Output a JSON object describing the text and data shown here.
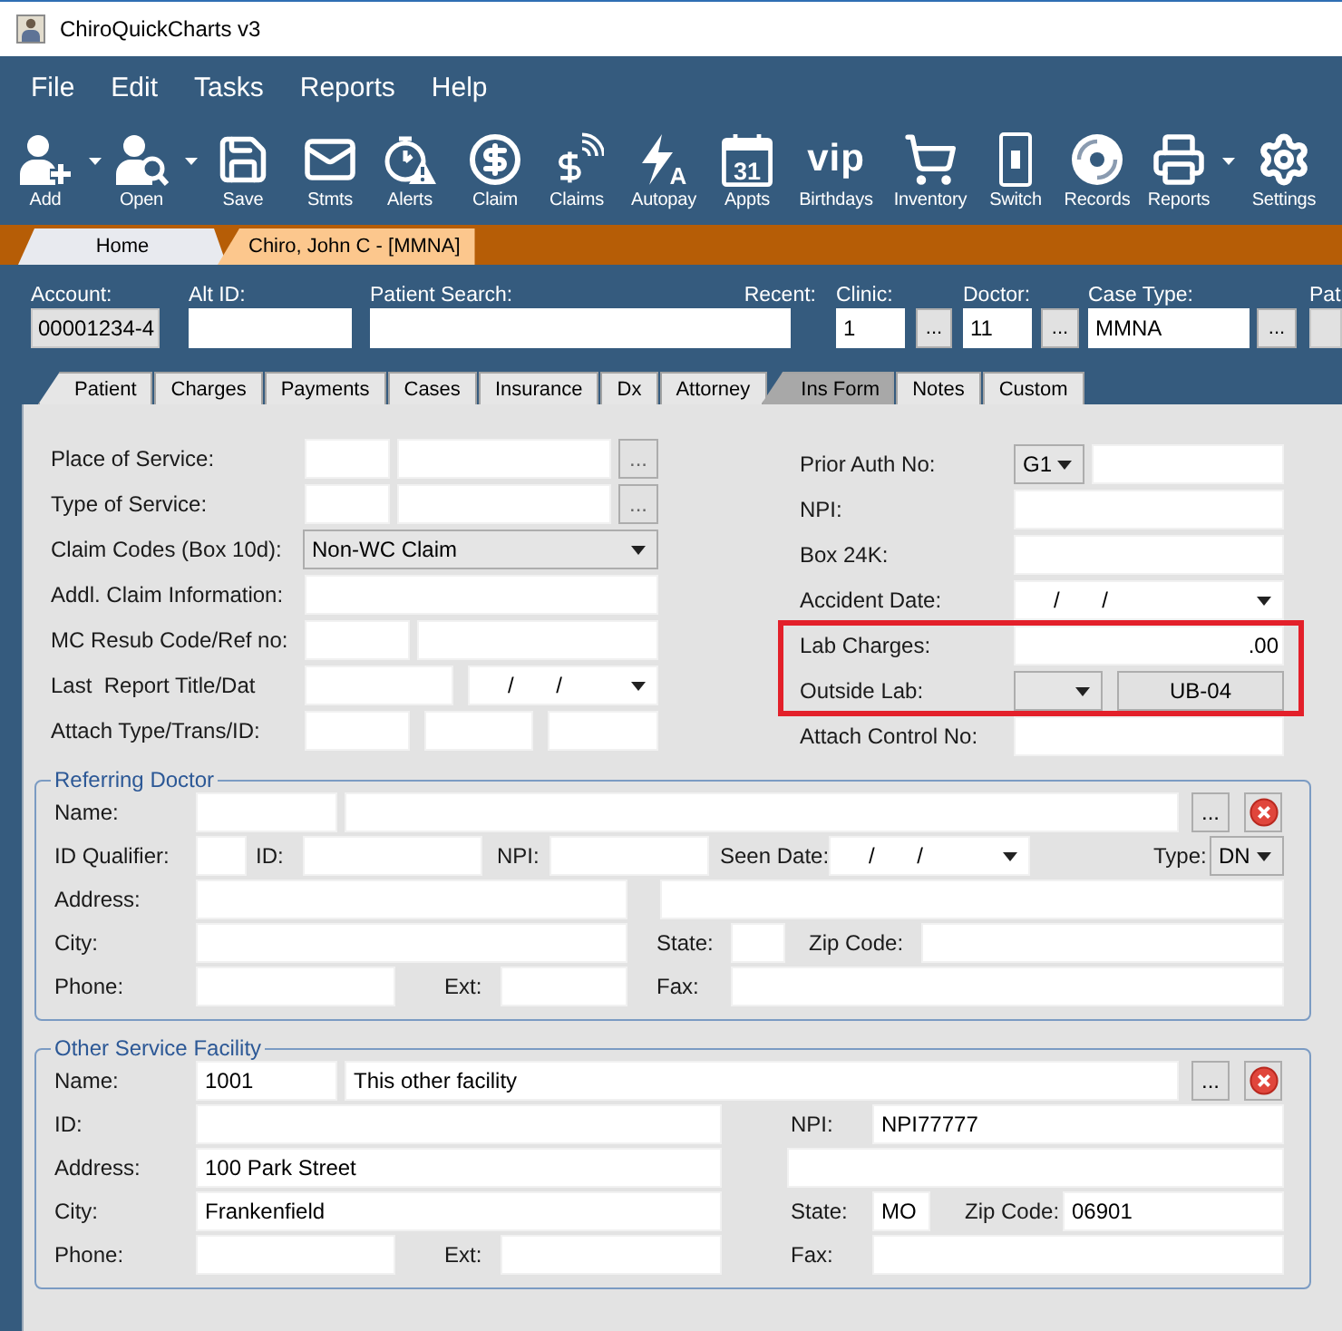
{
  "window": {
    "title": "ChiroQuickCharts v3"
  },
  "menu": [
    "File",
    "Edit",
    "Tasks",
    "Reports",
    "Help"
  ],
  "toolbar": [
    {
      "label": "Add",
      "dropdown": true
    },
    {
      "label": "Open",
      "dropdown": true
    },
    {
      "label": "Save",
      "dropdown": false
    },
    {
      "label": "Stmts",
      "dropdown": false
    },
    {
      "label": "Alerts",
      "dropdown": false
    },
    {
      "label": "Claim",
      "dropdown": false
    },
    {
      "label": "Claims",
      "dropdown": false
    },
    {
      "label": "Autopay",
      "dropdown": false,
      "icon_text": "A"
    },
    {
      "label": "Appts",
      "dropdown": false,
      "icon_text": "31"
    },
    {
      "label": "Birthdays",
      "dropdown": false,
      "icon_text": "vip"
    },
    {
      "label": "Inventory",
      "dropdown": false
    },
    {
      "label": "Switch",
      "dropdown": false
    },
    {
      "label": "Records",
      "dropdown": false
    },
    {
      "label": "Reports",
      "dropdown": true
    },
    {
      "label": "Settings",
      "dropdown": false
    }
  ],
  "document_tabs": [
    {
      "label": "Home",
      "selected": false
    },
    {
      "label": "Chiro, John C - [MMNA]",
      "selected": true
    }
  ],
  "header": [
    {
      "label": "Account:",
      "kind": "readonly",
      "value": "00001234-4"
    },
    {
      "label": "Alt ID:",
      "kind": "input"
    },
    {
      "label": "Patient Search:",
      "kind": "input",
      "aside": "Recent:"
    },
    {
      "label": "Clinic:",
      "kind": "picker",
      "value": "1",
      "button": "..."
    },
    {
      "label": "Doctor:",
      "kind": "picker",
      "value": "11",
      "button": "..."
    },
    {
      "label": "Case Type:",
      "kind": "picker",
      "value": "MMNA",
      "button": "..."
    },
    {
      "label": "Pat",
      "kind": "readonly"
    }
  ],
  "tabs": [
    {
      "label": "Patient",
      "selected": false
    },
    {
      "label": "Charges",
      "selected": false
    },
    {
      "label": "Payments",
      "selected": false
    },
    {
      "label": "Cases",
      "selected": false
    },
    {
      "label": "Insurance",
      "selected": false
    },
    {
      "label": "Dx",
      "selected": false
    },
    {
      "label": "Attorney",
      "selected": false
    },
    {
      "label": "Ins Form",
      "selected": true
    },
    {
      "label": "Notes",
      "selected": false
    },
    {
      "label": "Custom",
      "selected": false
    }
  ],
  "ins_form": {
    "left": [
      {
        "label": "Place of Service:",
        "controls": [
          {
            "kind": "field"
          },
          {
            "kind": "field"
          },
          {
            "kind": "browse",
            "text": "..."
          }
        ]
      },
      {
        "label": "Type of Service:",
        "controls": [
          {
            "kind": "field"
          },
          {
            "kind": "field"
          },
          {
            "kind": "browse",
            "text": "..."
          }
        ]
      },
      {
        "label": "Claim Codes (Box 10d):",
        "controls": [
          {
            "kind": "dropdown",
            "value": "Non-WC Claim"
          }
        ]
      },
      {
        "label": "Addl. Claim Information:",
        "controls": [
          {
            "kind": "field"
          }
        ]
      },
      {
        "label": "MC Resub Code/Ref no:",
        "controls": [
          {
            "kind": "field"
          },
          {
            "kind": "field"
          }
        ]
      },
      {
        "label": "Last  Report Title/Dat",
        "controls": [
          {
            "kind": "field"
          },
          {
            "kind": "date",
            "value": "/       /"
          }
        ]
      },
      {
        "label": "Attach Type/Trans/ID:",
        "controls": [
          {
            "kind": "field"
          },
          {
            "kind": "field"
          },
          {
            "kind": "field"
          }
        ]
      }
    ],
    "right": [
      {
        "label": "Prior Auth No:",
        "highlighted": false,
        "controls": [
          {
            "kind": "dropdown",
            "value": "G1"
          },
          {
            "kind": "field"
          }
        ]
      },
      {
        "label": "NPI:",
        "highlighted": false,
        "controls": [
          {
            "kind": "field"
          }
        ]
      },
      {
        "label": "Box 24K:",
        "highlighted": false,
        "controls": [
          {
            "kind": "field"
          }
        ]
      },
      {
        "label": "Accident Date:",
        "highlighted": false,
        "controls": [
          {
            "kind": "date",
            "value": "/       /"
          }
        ]
      },
      {
        "label": "Lab Charges:",
        "highlighted": true,
        "controls": [
          {
            "kind": "amount",
            "value": ".00"
          }
        ]
      },
      {
        "label": "Outside Lab:",
        "highlighted": true,
        "controls": [
          {
            "kind": "dropdown"
          },
          {
            "kind": "button",
            "text": "UB-04"
          }
        ]
      },
      {
        "label": "Attach Control No:",
        "highlighted": false,
        "controls": [
          {
            "kind": "field"
          }
        ]
      }
    ]
  },
  "referring_doctor": {
    "title": "Referring Doctor",
    "rows": [
      {
        "left": [
          {
            "kind": "label",
            "text": "Name:"
          },
          {
            "kind": "field"
          },
          {
            "kind": "field"
          },
          {
            "kind": "browse",
            "text": "..."
          },
          {
            "kind": "clear"
          }
        ]
      },
      {
        "left": [
          {
            "kind": "label",
            "text": "ID Qualifier:"
          },
          {
            "kind": "field"
          },
          {
            "kind": "label",
            "text": "ID:"
          },
          {
            "kind": "field"
          },
          {
            "kind": "label",
            "text": "NPI:"
          },
          {
            "kind": "field"
          }
        ],
        "right": [
          {
            "kind": "label",
            "text": "Seen Date:"
          },
          {
            "kind": "date",
            "value": "/       /"
          },
          {
            "kind": "label",
            "text": "Type:"
          },
          {
            "kind": "dropdown",
            "value": "DN"
          }
        ]
      },
      {
        "left": [
          {
            "kind": "label",
            "text": "Address:"
          },
          {
            "kind": "field"
          }
        ],
        "right": [
          {
            "kind": "field"
          }
        ]
      },
      {
        "left": [
          {
            "kind": "label",
            "text": "City:"
          },
          {
            "kind": "field"
          }
        ],
        "right": [
          {
            "kind": "label",
            "text": "State:"
          },
          {
            "kind": "field"
          },
          {
            "kind": "label",
            "text": "Zip Code:"
          },
          {
            "kind": "field"
          }
        ]
      },
      {
        "left": [
          {
            "kind": "label",
            "text": "Phone:"
          },
          {
            "kind": "field"
          },
          {
            "kind": "label",
            "text": "Ext:"
          },
          {
            "kind": "field"
          }
        ],
        "right": [
          {
            "kind": "label",
            "text": "Fax:"
          },
          {
            "kind": "field"
          }
        ]
      }
    ]
  },
  "other_service_facility": {
    "title": "Other Service Facility",
    "rows": [
      {
        "left": [
          {
            "kind": "label",
            "text": "Name:"
          },
          {
            "kind": "field",
            "value": "1001"
          },
          {
            "kind": "field",
            "value": "This other facility"
          },
          {
            "kind": "browse",
            "text": "..."
          },
          {
            "kind": "clear"
          }
        ]
      },
      {
        "left": [
          {
            "kind": "label",
            "text": "ID:"
          },
          {
            "kind": "field"
          }
        ],
        "right": [
          {
            "kind": "label",
            "text": "NPI:"
          },
          {
            "kind": "field",
            "value": "NPI77777"
          }
        ]
      },
      {
        "left": [
          {
            "kind": "label",
            "text": "Address:"
          },
          {
            "kind": "field",
            "value": "100 Park Street"
          }
        ],
        "right": [
          {
            "kind": "field"
          }
        ]
      },
      {
        "left": [
          {
            "kind": "label",
            "text": "City:"
          },
          {
            "kind": "field",
            "value": "Frankenfield"
          }
        ],
        "right": [
          {
            "kind": "label",
            "text": "State:"
          },
          {
            "kind": "field",
            "value": "MO"
          },
          {
            "kind": "label",
            "text": "Zip Code:"
          },
          {
            "kind": "field",
            "value": "06901"
          }
        ]
      },
      {
        "left": [
          {
            "kind": "label",
            "text": "Phone:"
          },
          {
            "kind": "field"
          },
          {
            "kind": "label",
            "text": "Ext:"
          },
          {
            "kind": "field"
          }
        ],
        "right": [
          {
            "kind": "label",
            "text": "Fax:"
          },
          {
            "kind": "field"
          }
        ]
      }
    ]
  }
}
